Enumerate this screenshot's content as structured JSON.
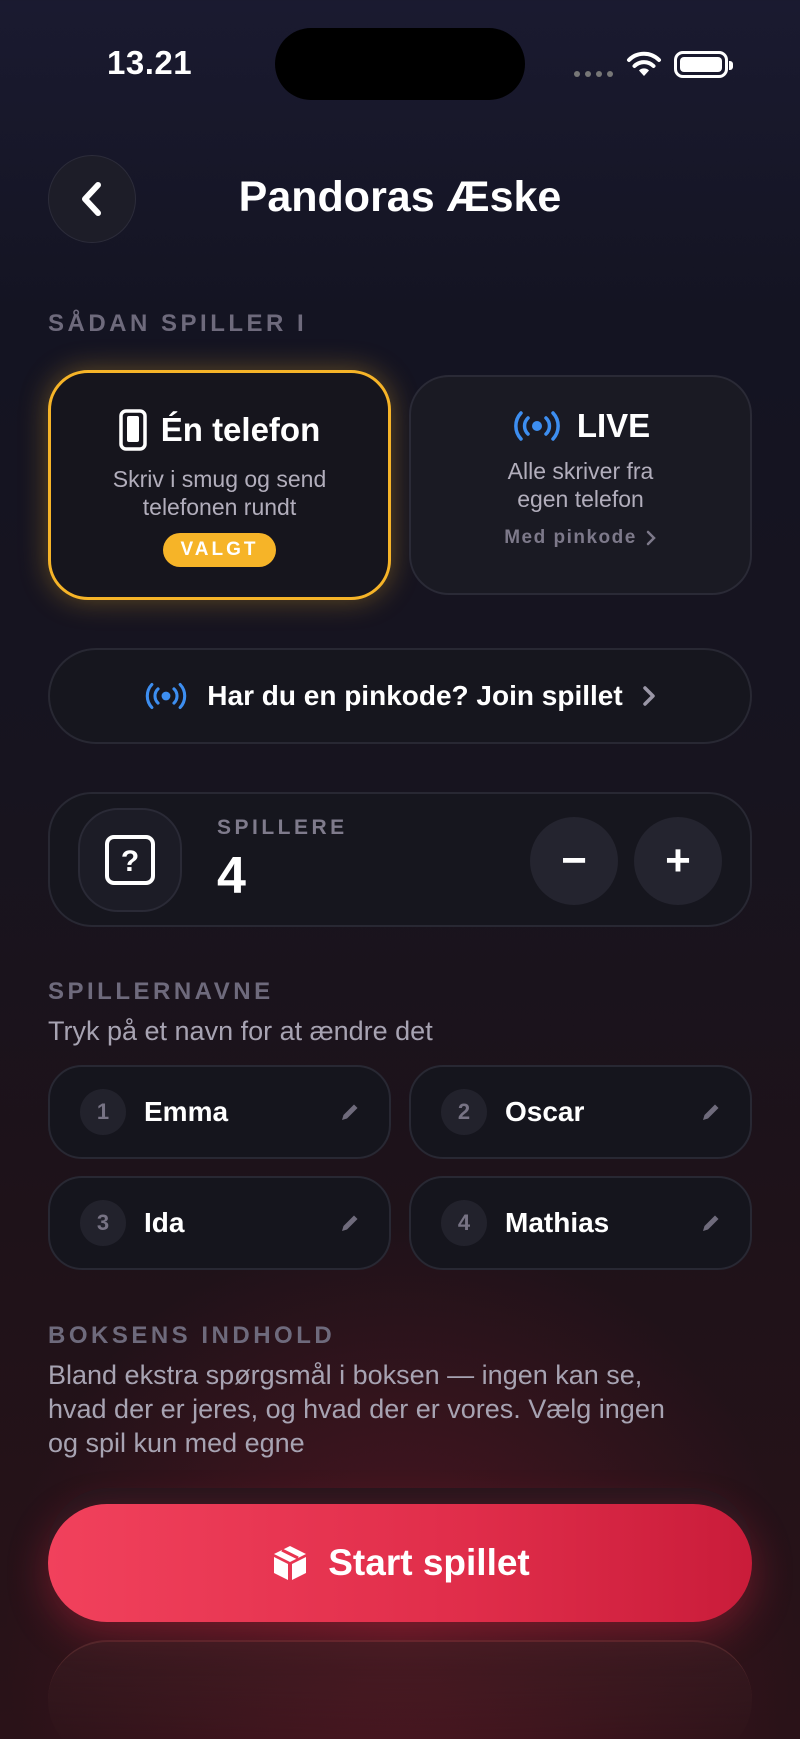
{
  "status_bar": {
    "time": "13.21"
  },
  "header": {
    "title": "Pandoras Æske"
  },
  "play_mode": {
    "section_label": "SÅDAN SPILLER I",
    "one_phone": {
      "title": "Én telefon",
      "desc_line1": "Skriv i smug og send",
      "desc_line2": "telefonen rundt",
      "badge": "VALGT"
    },
    "live": {
      "title": "LIVE",
      "desc_line1": "Alle skriver fra",
      "desc_line2": "egen telefon",
      "link": "Med pinkode"
    }
  },
  "join": {
    "label": "Har du en pinkode? Join spillet"
  },
  "players": {
    "label": "SPILLERE",
    "count": "4",
    "minus": "−",
    "plus": "+"
  },
  "names": {
    "section_label": "SPILLERNAVNE",
    "hint": "Tryk på et navn for at ændre det",
    "list": [
      {
        "num": "1",
        "name": "Emma"
      },
      {
        "num": "2",
        "name": "Oscar"
      },
      {
        "num": "3",
        "name": "Ida"
      },
      {
        "num": "4",
        "name": "Mathias"
      }
    ]
  },
  "box_content": {
    "section_label": "BOKSENS INDHOLD",
    "line1": "Bland ekstra spørgsmål i boksen — ingen kan se,",
    "line2": "hvad der er jeres, og hvad der er vores. Vælg ingen",
    "line3": "og spil kun med egne"
  },
  "start": {
    "label": "Start spillet"
  },
  "colors": {
    "accent_yellow": "#f6b428",
    "live_blue": "#3d8ef0",
    "start_red": "#e8344f"
  },
  "icons": [
    "wifi-icon",
    "battery-icon",
    "chevron-left-icon",
    "phone-icon",
    "broadcast-icon",
    "chevron-right-icon",
    "dice-icon",
    "pencil-icon",
    "box-icon"
  ]
}
